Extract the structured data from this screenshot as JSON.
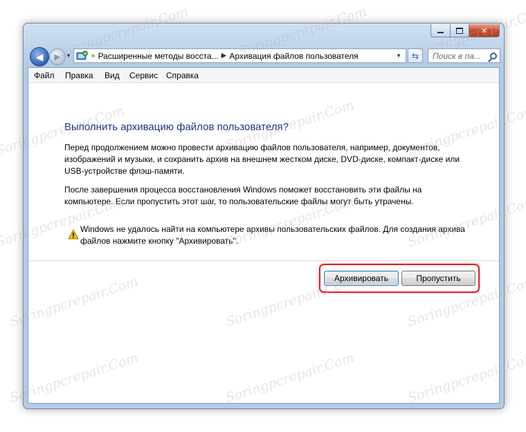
{
  "address": {
    "chevron": "«",
    "crumbs": [
      "Расширенные методы восста...",
      "Архивация файлов пользователя"
    ],
    "search_placeholder": "Поиск в па..."
  },
  "menu": {
    "items": [
      {
        "label": "Файл"
      },
      {
        "label": "Правка"
      },
      {
        "label": "Вид"
      },
      {
        "label": "Сервис"
      },
      {
        "label": "Справка"
      }
    ]
  },
  "main": {
    "title": "Выполнить архивацию файлов пользователя?",
    "para1_lines": [
      "Перед продолжением можно провести архивацию файлов пользователя, например, документов,",
      "изображений и музыки, и сохранить архив на внешнем жестком диске, DVD-диске, компакт-диске или",
      "USB-устройстве флэш-памяти."
    ],
    "para2_lines": [
      "После завершения процесса восстановления Windows поможет восстановить эти файлы на",
      "компьютере. Если пропустить этот шаг, то пользовательские файлы могут быть утрачены."
    ],
    "warning_lines": [
      "Windows не удалось найти на компьютере архивы пользовательских файлов. Для создания архива",
      "файлов нажмите кнопку \"Архивировать\"."
    ]
  },
  "buttons": {
    "archive": "Архивировать",
    "skip": "Пропустить"
  },
  "watermark_text": "Soringpcrepair.Com",
  "colors": {
    "title": "#1e3287",
    "highlight": "#d8232a",
    "warning": "#f2c200"
  }
}
